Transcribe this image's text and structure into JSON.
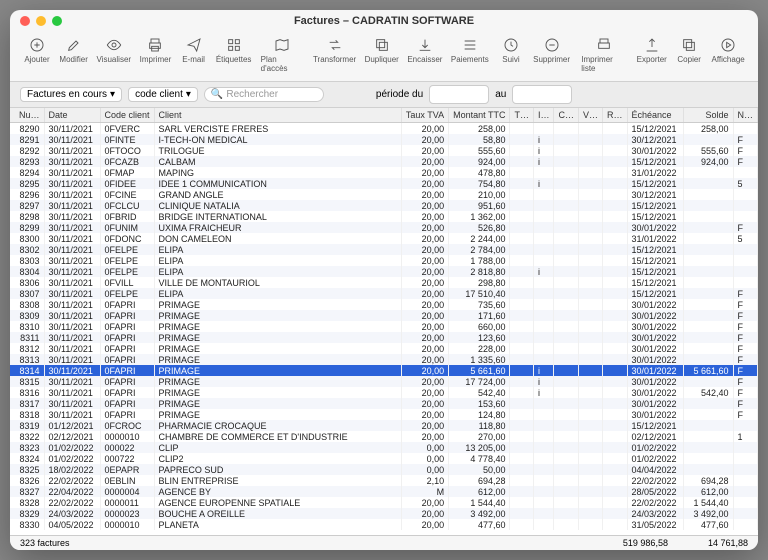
{
  "window": {
    "title": "Factures – CADRATIN SOFTWARE"
  },
  "toolbar": {
    "ajouter": "Ajouter",
    "modifier": "Modifier",
    "visualiser": "Visualiser",
    "imprimer": "Imprimer",
    "email": "E-mail",
    "etiquettes": "Étiquettes",
    "plan": "Plan d'accès",
    "transformer": "Transformer",
    "dupliquer": "Dupliquer",
    "encaisser": "Encaisser",
    "paiements": "Paiements",
    "suivi": "Suivi",
    "supprimer": "Supprimer",
    "imprimer_liste": "Imprimer liste",
    "exporter": "Exporter",
    "copier": "Copier",
    "affichage": "Affichage"
  },
  "filter": {
    "factures_en_cours": "Factures en cours",
    "code_client": "code client",
    "search_placeholder": "Rechercher",
    "periode_du": "période du",
    "au": "au"
  },
  "columns": {
    "nu": "Nu…",
    "date": "Date",
    "code_client": "Code client",
    "client": "Client",
    "taux_tva": "Taux TVA",
    "montant_ttc": "Montant TTC",
    "t": "T…",
    "i": "I…",
    "c": "C…",
    "v": "V…",
    "r": "R…",
    "echeance": "Échéance",
    "solde": "Solde",
    "n": "N…"
  },
  "rows": [
    {
      "n": "8290",
      "d": "30/11/2021",
      "cc": "0FVERC",
      "cl": "SARL VERCISTE FRERES",
      "tva": "20,00",
      "ttc": "258,00",
      "e": "15/12/2021",
      "s": "258,00",
      "f": ""
    },
    {
      "n": "8291",
      "d": "30/11/2021",
      "cc": "0FINTE",
      "cl": "I-TECH-ON MEDICAL",
      "tva": "20,00",
      "ttc": "58,80",
      "i": "i",
      "e": "30/12/2021",
      "s": "",
      "f": "F"
    },
    {
      "n": "8292",
      "d": "30/11/2021",
      "cc": "0FTOCO",
      "cl": "TRILOGUE",
      "tva": "20,00",
      "ttc": "555,60",
      "i": "i",
      "e": "30/01/2022",
      "s": "555,60",
      "f": "F"
    },
    {
      "n": "8293",
      "d": "30/11/2021",
      "cc": "0FCAZB",
      "cl": "CALBAM",
      "tva": "20,00",
      "ttc": "924,00",
      "i": "i",
      "e": "15/12/2021",
      "s": "924,00",
      "f": "F"
    },
    {
      "n": "8294",
      "d": "30/11/2021",
      "cc": "0FMAP",
      "cl": "MAPING",
      "tva": "20,00",
      "ttc": "478,80",
      "e": "31/01/2022",
      "s": "",
      "f": ""
    },
    {
      "n": "8295",
      "d": "30/11/2021",
      "cc": "0FIDEE",
      "cl": "IDEE 1 COMMUNICATION",
      "tva": "20,00",
      "ttc": "754,80",
      "i": "i",
      "e": "15/12/2021",
      "s": "",
      "f": "5"
    },
    {
      "n": "8296",
      "d": "30/11/2021",
      "cc": "0FCINE",
      "cl": "GRAND  ANGLE",
      "tva": "20,00",
      "ttc": "210,00",
      "e": "30/12/2021",
      "s": "",
      "f": ""
    },
    {
      "n": "8297",
      "d": "30/11/2021",
      "cc": "0FCLCU",
      "cl": "CLINIQUE NATALIA",
      "tva": "20,00",
      "ttc": "951,60",
      "e": "15/12/2021",
      "s": "",
      "f": ""
    },
    {
      "n": "8298",
      "d": "30/11/2021",
      "cc": "0FBRID",
      "cl": "BRIDGE INTERNATIONAL",
      "tva": "20,00",
      "ttc": "1 362,00",
      "e": "15/12/2021",
      "s": "",
      "f": ""
    },
    {
      "n": "8299",
      "d": "30/11/2021",
      "cc": "0FUNIM",
      "cl": "UXIMA FRAICHEUR",
      "tva": "20,00",
      "ttc": "526,80",
      "e": "30/01/2022",
      "s": "",
      "f": "F"
    },
    {
      "n": "8300",
      "d": "30/11/2021",
      "cc": "0FDONC",
      "cl": "DON CAMELEON",
      "tva": "20,00",
      "ttc": "2 244,00",
      "e": "31/01/2022",
      "s": "",
      "f": "5"
    },
    {
      "n": "8302",
      "d": "30/11/2021",
      "cc": "0FELPE",
      "cl": "ELIPA",
      "tva": "20,00",
      "ttc": "2 784,00",
      "e": "15/12/2021",
      "s": "",
      "f": ""
    },
    {
      "n": "8303",
      "d": "30/11/2021",
      "cc": "0FELPE",
      "cl": "ELIPA",
      "tva": "20,00",
      "ttc": "1 788,00",
      "e": "15/12/2021",
      "s": "",
      "f": ""
    },
    {
      "n": "8304",
      "d": "30/11/2021",
      "cc": "0FELPE",
      "cl": "ELIPA",
      "tva": "20,00",
      "ttc": "2 818,80",
      "i": "i",
      "e": "15/12/2021",
      "s": "",
      "f": ""
    },
    {
      "n": "8306",
      "d": "30/11/2021",
      "cc": "0FVILL",
      "cl": "VILLE DE MONTAURIOL",
      "tva": "20,00",
      "ttc": "298,80",
      "e": "15/12/2021",
      "s": "",
      "f": ""
    },
    {
      "n": "8307",
      "d": "30/11/2021",
      "cc": "0FELPE",
      "cl": "ELIPA",
      "tva": "20,00",
      "ttc": "17 510,40",
      "e": "15/12/2021",
      "s": "",
      "f": "F"
    },
    {
      "n": "8308",
      "d": "30/11/2021",
      "cc": "0FAPRI",
      "cl": "PRIMAGE",
      "tva": "20,00",
      "ttc": "735,60",
      "e": "30/01/2022",
      "s": "",
      "f": "F"
    },
    {
      "n": "8309",
      "d": "30/11/2021",
      "cc": "0FAPRI",
      "cl": "PRIMAGE",
      "tva": "20,00",
      "ttc": "171,60",
      "e": "30/01/2022",
      "s": "",
      "f": "F"
    },
    {
      "n": "8310",
      "d": "30/11/2021",
      "cc": "0FAPRI",
      "cl": "PRIMAGE",
      "tva": "20,00",
      "ttc": "660,00",
      "e": "30/01/2022",
      "s": "",
      "f": "F"
    },
    {
      "n": "8311",
      "d": "30/11/2021",
      "cc": "0FAPRI",
      "cl": "PRIMAGE",
      "tva": "20,00",
      "ttc": "123,60",
      "e": "30/01/2022",
      "s": "",
      "f": "F"
    },
    {
      "n": "8312",
      "d": "30/11/2021",
      "cc": "0FAPRI",
      "cl": "PRIMAGE",
      "tva": "20,00",
      "ttc": "228,00",
      "e": "30/01/2022",
      "s": "",
      "f": "F"
    },
    {
      "n": "8313",
      "d": "30/11/2021",
      "cc": "0FAPRI",
      "cl": "PRIMAGE",
      "tva": "20,00",
      "ttc": "1 335,60",
      "e": "30/01/2022",
      "s": "",
      "f": "F"
    },
    {
      "n": "8314",
      "d": "30/11/2021",
      "cc": "0FAPRI",
      "cl": "PRIMAGE",
      "tva": "20,00",
      "ttc": "5 661,60",
      "i": "i",
      "e": "30/01/2022",
      "s": "5 661,60",
      "f": "F",
      "sel": true
    },
    {
      "n": "8315",
      "d": "30/11/2021",
      "cc": "0FAPRI",
      "cl": "PRIMAGE",
      "tva": "20,00",
      "ttc": "17 724,00",
      "i": "i",
      "e": "30/01/2022",
      "s": "",
      "f": "F"
    },
    {
      "n": "8316",
      "d": "30/11/2021",
      "cc": "0FAPRI",
      "cl": "PRIMAGE",
      "tva": "20,00",
      "ttc": "542,40",
      "i": "i",
      "e": "30/01/2022",
      "s": "542,40",
      "f": "F"
    },
    {
      "n": "8317",
      "d": "30/11/2021",
      "cc": "0FAPRI",
      "cl": "PRIMAGE",
      "tva": "20,00",
      "ttc": "153,60",
      "e": "30/01/2022",
      "s": "",
      "f": "F"
    },
    {
      "n": "8318",
      "d": "30/11/2021",
      "cc": "0FAPRI",
      "cl": "PRIMAGE",
      "tva": "20,00",
      "ttc": "124,80",
      "e": "30/01/2022",
      "s": "",
      "f": "F"
    },
    {
      "n": "8319",
      "d": "01/12/2021",
      "cc": "0FCROC",
      "cl": "PHARMACIE CROCAQUE",
      "tva": "20,00",
      "ttc": "118,80",
      "e": "15/12/2021",
      "s": "",
      "f": ""
    },
    {
      "n": "8322",
      "d": "02/12/2021",
      "cc": "0000010",
      "cl": "CHAMBRE DE COMMERCE ET D'INDUSTRIE",
      "tva": "20,00",
      "ttc": "270,00",
      "e": "02/12/2021",
      "s": "",
      "f": "1"
    },
    {
      "n": "8323",
      "d": "01/02/2022",
      "cc": "000022",
      "cl": "CLIP",
      "tva": "0,00",
      "ttc": "13 205,00",
      "e": "01/02/2022",
      "s": "",
      "f": ""
    },
    {
      "n": "8324",
      "d": "01/02/2022",
      "cc": "000722",
      "cl": "CLIP2",
      "tva": "0,00",
      "ttc": "4 778,40",
      "e": "01/02/2022",
      "s": "",
      "f": ""
    },
    {
      "n": "8325",
      "d": "18/02/2022",
      "cc": "0EPAPR",
      "cl": "PAPRECO SUD",
      "tva": "0,00",
      "ttc": "50,00",
      "e": "04/04/2022",
      "s": "",
      "f": ""
    },
    {
      "n": "8326",
      "d": "22/02/2022",
      "cc": "0EBLIN",
      "cl": "BLIN ENTREPRISE",
      "tva": "2,10",
      "ttc": "694,28",
      "e": "22/02/2022",
      "s": "694,28",
      "f": ""
    },
    {
      "n": "8327",
      "d": "22/04/2022",
      "cc": "0000004",
      "cl": "AGENCE BY",
      "tva": "M",
      "ttc": "612,00",
      "e": "28/05/2022",
      "s": "612,00",
      "f": ""
    },
    {
      "n": "8328",
      "d": "22/02/2022",
      "cc": "0000011",
      "cl": "AGENCE EUROPENNE SPATIALE",
      "tva": "20,00",
      "ttc": "1 544,40",
      "e": "22/02/2022",
      "s": "1 544,40",
      "f": ""
    },
    {
      "n": "8329",
      "d": "24/03/2022",
      "cc": "0000023",
      "cl": "BOUCHE A OREILLE",
      "tva": "20,00",
      "ttc": "3 492,00",
      "e": "24/03/2022",
      "s": "3 492,00",
      "f": ""
    },
    {
      "n": "8330",
      "d": "04/05/2022",
      "cc": "0000010",
      "cl": "PLANETA",
      "tva": "20,00",
      "ttc": "477,60",
      "e": "31/05/2022",
      "s": "477,60",
      "f": ""
    }
  ],
  "footer": {
    "count": "323 factures",
    "total_ttc": "519 986,58",
    "total_solde": "14 761,88"
  }
}
